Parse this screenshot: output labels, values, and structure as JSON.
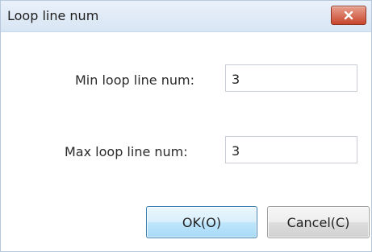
{
  "dialog": {
    "title": "Loop line num",
    "close_icon": "close-x-icon"
  },
  "fields": {
    "min_label": "Min loop line num:",
    "min_value": "3",
    "max_label": "Max loop line num:",
    "max_value": "3"
  },
  "buttons": {
    "ok_label": "OK(O)",
    "cancel_label": "Cancel(C)"
  },
  "colors": {
    "close_button": "#c8452d",
    "ok_border": "#3c7fb1"
  }
}
